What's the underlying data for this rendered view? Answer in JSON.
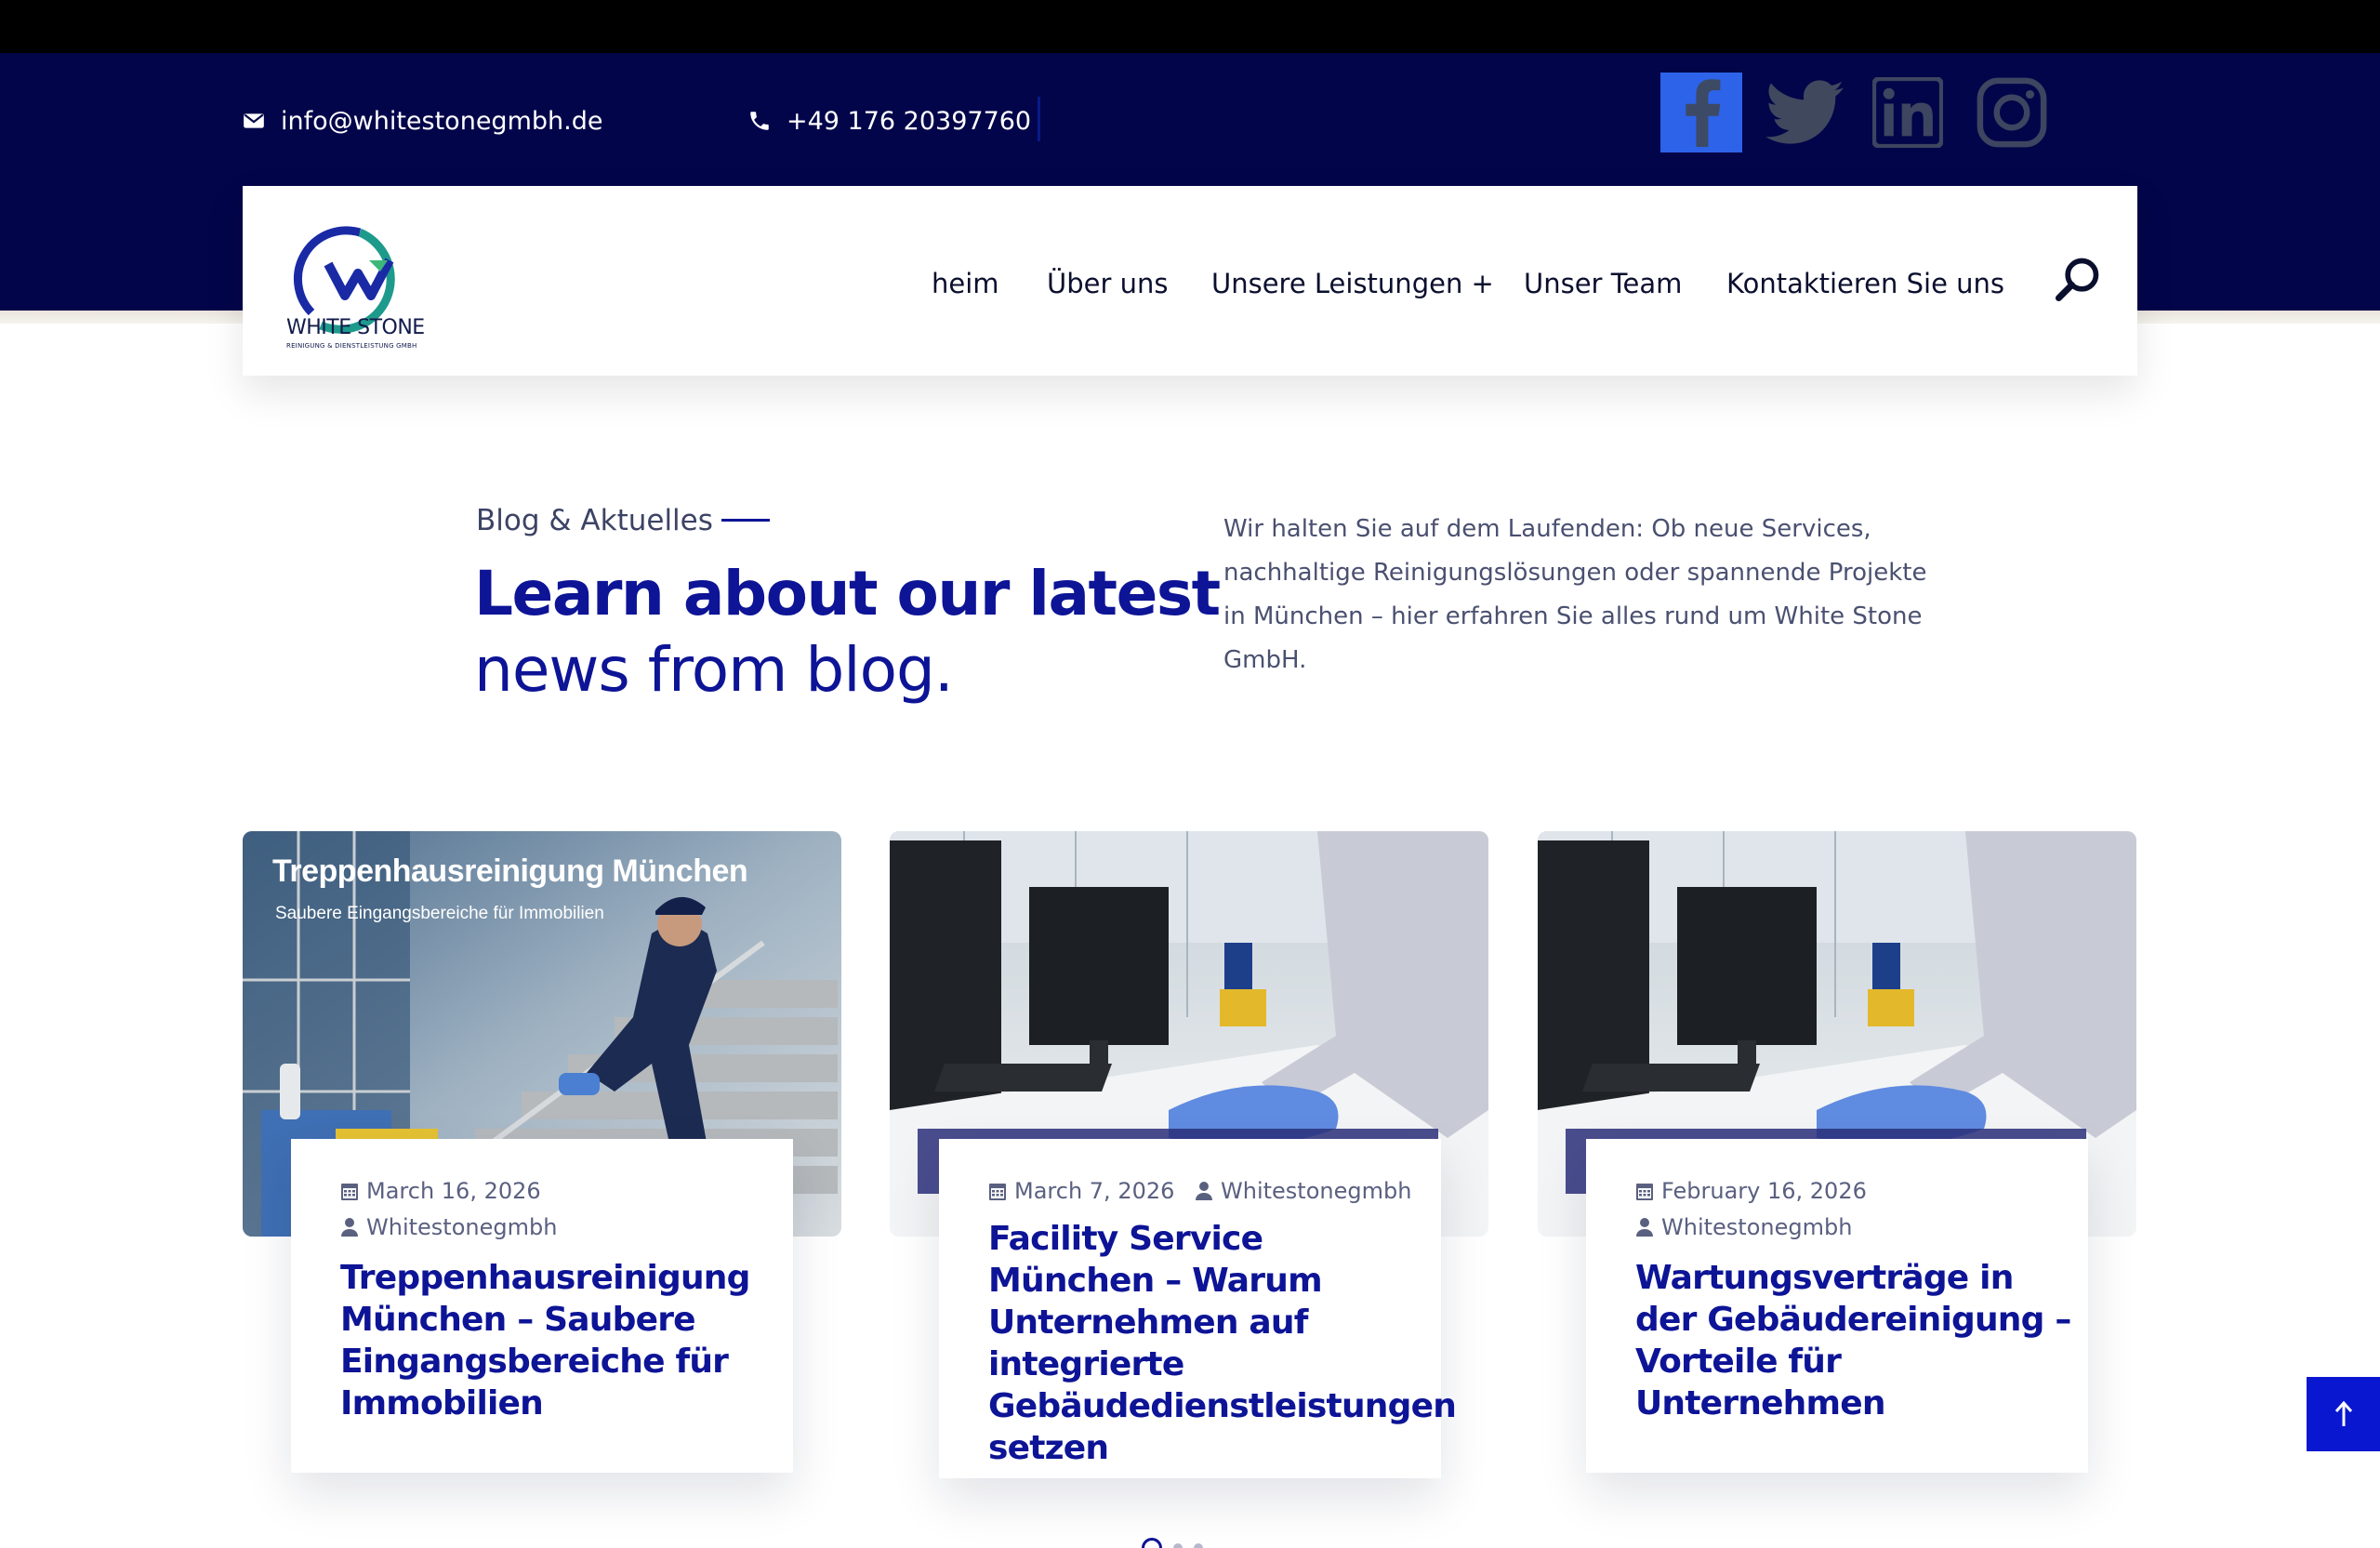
{
  "contact": {
    "email": "info@whitestonegmbh.de",
    "phone": "+49 176 20397760"
  },
  "social": [
    "facebook-icon",
    "twitter-icon",
    "linkedin-icon",
    "instagram-icon"
  ],
  "logo": {
    "title": "WHITE STONE",
    "subtitle": "REINIGUNG & DIENSTLEISTUNG GMBH"
  },
  "nav": {
    "items": [
      "heim",
      "Über uns",
      "Unsere Leistungen +",
      "Unser Team",
      "Kontaktieren Sie uns"
    ]
  },
  "intro": {
    "eyebrow": "Blog & Aktuelles",
    "headline_bold": "Learn about our latest",
    "headline_light": "news from blog.",
    "text": "Wir halten Sie auf dem Laufenden: Ob neue Services, nachhaltige Reinigungslösungen oder spannende Projekte in München – hier erfahren Sie alles rund um White Stone GmbH."
  },
  "posts": [
    {
      "image_title": "Treppenhausreinigung München",
      "image_subtitle": "Saubere Eingangsbereiche für Immobilien",
      "date": "March 16, 2026",
      "author": "Whitestonegmbh",
      "title": "Treppenhausreinigung München – Saubere Eingangsbereiche für Immobilien"
    },
    {
      "date": "March 7, 2026",
      "author": "Whitestonegmbh",
      "title": "Facility Service München – Warum Unternehmen auf integrierte Gebäudedienstleistungen setzen"
    },
    {
      "date": "February 16, 2026",
      "author": "Whitestonegmbh",
      "title": "Wartungsverträge in der Gebäudereinigung – Vorteile für Unternehmen"
    }
  ],
  "colors": {
    "navy_bar": "#03054a",
    "accent_blue": "#0d1496",
    "facebook_blue": "#2d63e8",
    "scroll_top": "#0a17d0"
  },
  "icons": {
    "search": "search-icon",
    "scroll_top": "arrow-up-icon",
    "date": "calendar-icon",
    "author": "user-icon"
  }
}
